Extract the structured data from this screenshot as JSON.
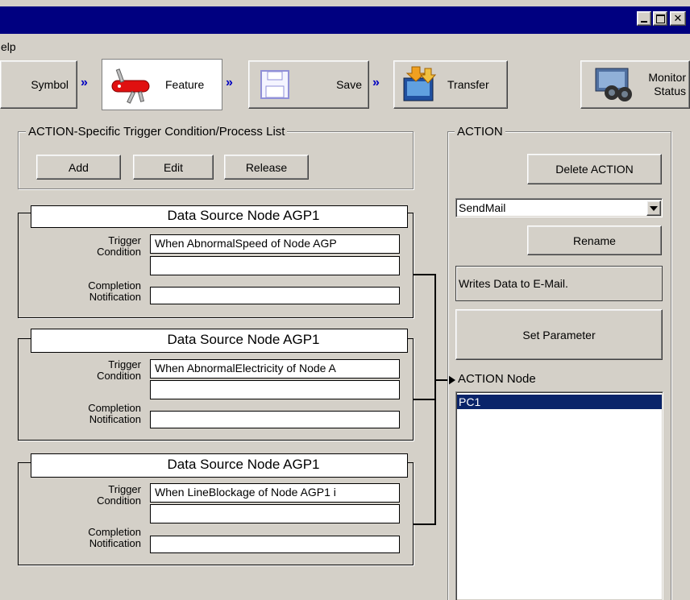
{
  "menu": {
    "help_label": "elp"
  },
  "toolbar": {
    "steps": [
      {
        "label": "Symbol"
      },
      {
        "label": "Feature"
      },
      {
        "label": "Save"
      },
      {
        "label": "Transfer"
      }
    ],
    "monitor": {
      "line1": "Monitor",
      "line2": "Status"
    }
  },
  "trigger_list": {
    "title": "ACTION-Specific Trigger Condition/Process List",
    "add_label": "Add",
    "edit_label": "Edit",
    "release_label": "Release",
    "trigger_label_1": "Trigger",
    "trigger_label_2": "Condition",
    "completion_label_1": "Completion",
    "completion_label_2": "Notification",
    "panels": [
      {
        "title": "Data Source Node AGP1",
        "trigger": "When  AbnormalSpeed  of  Node AGP"
      },
      {
        "title": "Data Source Node AGP1",
        "trigger": "When  AbnormalElectricity  of  Node A"
      },
      {
        "title": "Data Source Node AGP1",
        "trigger": "When  LineBlockage  of  Node AGP1 i"
      }
    ]
  },
  "action": {
    "title": "ACTION",
    "delete_label": "Delete ACTION",
    "selected": "SendMail",
    "rename_label": "Rename",
    "description": "Writes Data to E-Mail.",
    "set_param_label": "Set Parameter",
    "node_label": "ACTION Node",
    "nodes": [
      "PC1"
    ]
  },
  "colors": {
    "titlebar": "#000080",
    "face": "#d4d0c8",
    "selection": "#0a246a"
  }
}
